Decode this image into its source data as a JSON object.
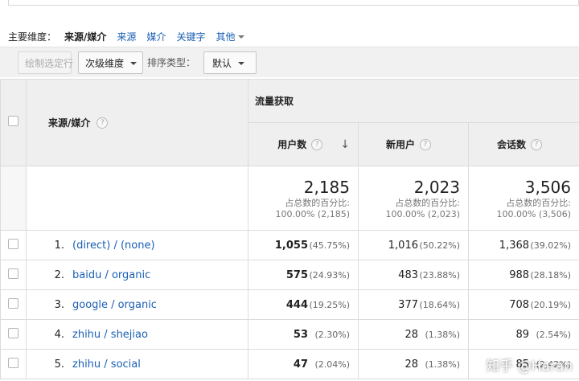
{
  "dimension_bar": {
    "label": "主要维度：",
    "active": "来源/媒介",
    "links": [
      "来源",
      "媒介",
      "关键字"
    ],
    "other": "其他"
  },
  "toolbar": {
    "plot_rows": "绘制选定行",
    "secondary_dimension": "次级维度",
    "sort_type_label": "排序类型：",
    "sort_type_value": "默认"
  },
  "table": {
    "group_header": "流量获取",
    "dimension_header": "来源/媒介",
    "columns": [
      "用户数",
      "新用户",
      "会话数"
    ],
    "help_glyph": "?",
    "sort_arrow": "↓",
    "totals": [
      {
        "value": "2,185",
        "caption": "占总数的百分比:",
        "detail": "100.00% (2,185)"
      },
      {
        "value": "2,023",
        "caption": "占总数的百分比:",
        "detail": "100.00% (2,023)"
      },
      {
        "value": "3,506",
        "caption": "占总数的百分比:",
        "detail": "100.00% (3,506)"
      }
    ],
    "rows": [
      {
        "num": "1.",
        "source": "(direct) / (none)",
        "users": "1,055",
        "users_pct": "(45.75%)",
        "new_users": "1,016",
        "new_users_pct": "(50.22%)",
        "sessions": "1,368",
        "sessions_pct": "(39.02%)"
      },
      {
        "num": "2.",
        "source": "baidu / organic",
        "users": "575",
        "users_pct": "(24.93%)",
        "new_users": "483",
        "new_users_pct": "(23.88%)",
        "sessions": "988",
        "sessions_pct": "(28.18%)"
      },
      {
        "num": "3.",
        "source": "google / organic",
        "users": "444",
        "users_pct": "(19.25%)",
        "new_users": "377",
        "new_users_pct": "(18.64%)",
        "sessions": "708",
        "sessions_pct": "(20.19%)"
      },
      {
        "num": "4.",
        "source": "zhihu / shejiao",
        "users": "53",
        "users_pct": "(2.30%)",
        "new_users": "28",
        "new_users_pct": "(1.38%)",
        "sessions": "89",
        "sessions_pct": "(2.54%)"
      },
      {
        "num": "5.",
        "source": "zhihu / social",
        "users": "47",
        "users_pct": "(2.04%)",
        "new_users": "28",
        "new_users_pct": "(1.38%)",
        "sessions": "85",
        "sessions_pct": "(2.42%)"
      }
    ]
  },
  "watermark": "知乎 @Haran",
  "colors": {
    "link": "#1a5fb4",
    "header_bg": "#efefef",
    "toolbar_bg": "#f1f1f1"
  }
}
